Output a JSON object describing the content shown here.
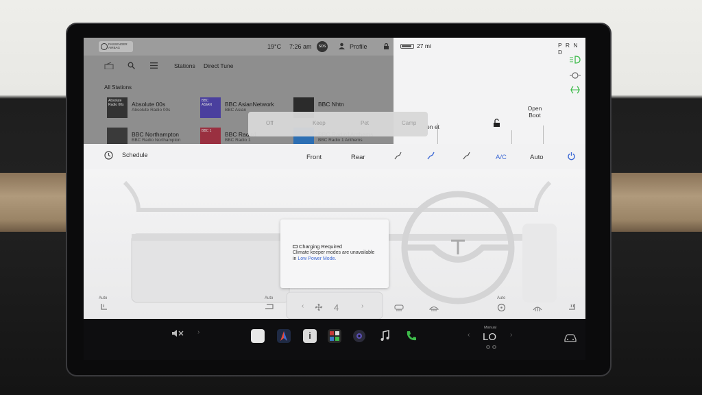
{
  "status_bar": {
    "airbag_label": "PASSENGER AIRBAG",
    "temperature": "19°C",
    "time": "7:26 am",
    "sos_label": "SOS",
    "profile_label": "Profile",
    "range": "27 mi",
    "gear": "P R N D"
  },
  "media": {
    "nav": [
      "Stations",
      "Direct Tune"
    ],
    "section_title": "All Stations",
    "stations": [
      {
        "name": "Absolute 00s",
        "sub": "Absolute Radio 00s",
        "art": "Absolute Radio 00s"
      },
      {
        "name": "BBC AsianNetwork",
        "sub": "BBC Asian",
        "art": "BBC ASIAN"
      },
      {
        "name": "BBC Nhtn",
        "sub": "",
        "art": ""
      },
      {
        "name": "BBC Northampton",
        "sub": "BBC Radio Northampton",
        "art": ""
      },
      {
        "name": "BBC Radio1",
        "sub": "BBC Radio 1",
        "art": "BBC 1"
      },
      {
        "name": "BBC Radio1Anthems",
        "sub": "BBC Radio 1 Anthems",
        "art": ""
      }
    ]
  },
  "keeper": {
    "options": [
      "Off",
      "Keep",
      "Pet",
      "Camp"
    ]
  },
  "car": {
    "open_boot": "Open Boot",
    "open_frunk_partial": "en et"
  },
  "climate": {
    "schedule": "Schedule",
    "front": "Front",
    "rear": "Rear",
    "ac": "A/C",
    "auto": "Auto",
    "fan_speed": "4",
    "auto_small": "Auto",
    "popup_title": "Charging Required",
    "popup_line1": "Climate keeper modes are unavailable",
    "popup_line2_prefix": "in ",
    "popup_link": "Low Power Mode.",
    "accent_color": "#3e6ad5"
  },
  "taskbar": {
    "temp_mode": "Manual",
    "temp_value": "LO"
  }
}
